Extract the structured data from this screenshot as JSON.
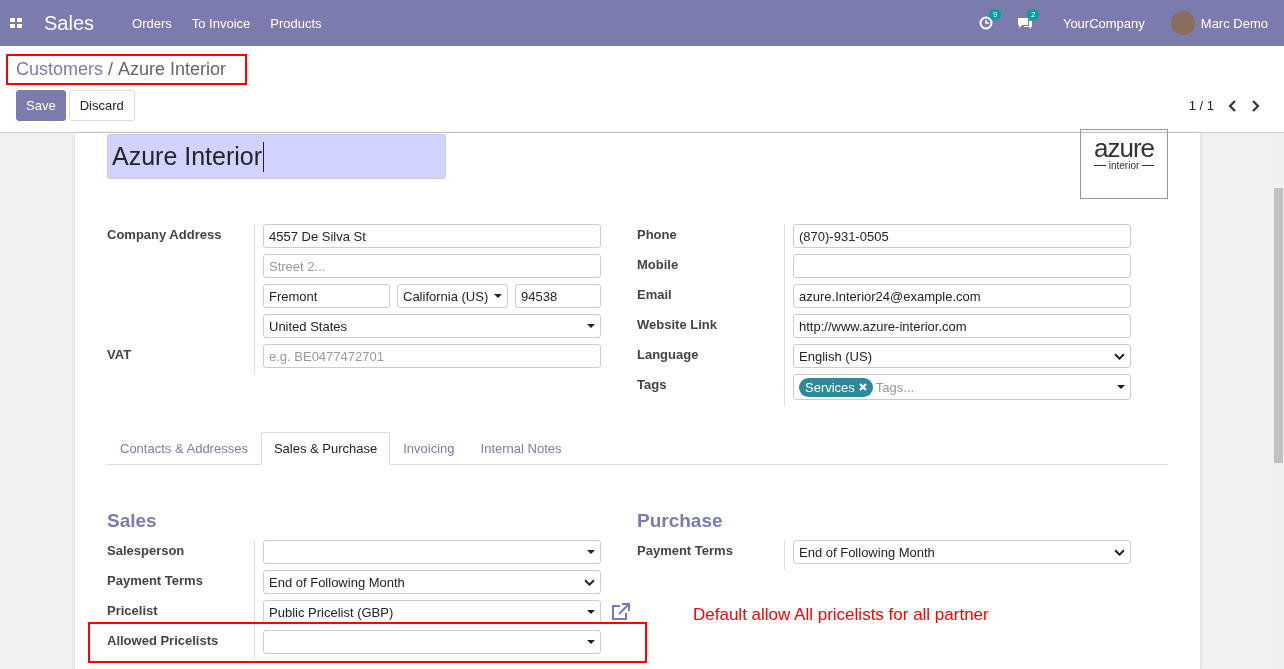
{
  "navbar": {
    "app": "Sales",
    "menu": [
      "Orders",
      "To Invoice",
      "Products"
    ],
    "activity_count": "9",
    "message_count": "2",
    "company": "YourCompany",
    "user": "Marc Demo"
  },
  "breadcrumb": {
    "parent": "Customers",
    "separator": "/",
    "current": "Azure Interior"
  },
  "buttons": {
    "save": "Save",
    "discard": "Discard"
  },
  "pager": "1 / 1",
  "record": {
    "name": "Azure Interior",
    "logo": {
      "word": "azure",
      "sub": "interior"
    }
  },
  "left_fields": [
    {
      "label": "Company Address",
      "rows": [
        [
          {
            "kind": "input",
            "value": "4557 De Silva St"
          }
        ],
        [
          {
            "kind": "input",
            "placeholder": "Street 2..."
          }
        ],
        [
          {
            "kind": "input",
            "value": "Fremont"
          },
          {
            "kind": "dropdown",
            "value": "California (US)"
          },
          {
            "kind": "input",
            "value": "94538"
          }
        ],
        [
          {
            "kind": "dropdown",
            "value": "United States"
          }
        ]
      ]
    },
    {
      "label": "VAT",
      "rows": [
        [
          {
            "kind": "input",
            "placeholder": "e.g. BE0477472701"
          }
        ]
      ]
    }
  ],
  "right_fields": [
    {
      "label": "Phone",
      "rows": [
        [
          {
            "kind": "input",
            "value": "(870)-931-0505"
          }
        ]
      ]
    },
    {
      "label": "Mobile",
      "rows": [
        [
          {
            "kind": "input"
          }
        ]
      ]
    },
    {
      "label": "Email",
      "rows": [
        [
          {
            "kind": "input",
            "value": "azure.Interior24@example.com"
          }
        ]
      ]
    },
    {
      "label": "Website Link",
      "rows": [
        [
          {
            "kind": "input",
            "value": "http://www.azure-interior.com"
          }
        ]
      ]
    },
    {
      "label": "Language",
      "rows": [
        [
          {
            "kind": "select",
            "value": "English (US)"
          }
        ]
      ]
    },
    {
      "label": "Tags",
      "rows": [
        [
          {
            "kind": "tags",
            "tags": [
              "Services"
            ],
            "placeholder": "Tags..."
          }
        ]
      ]
    }
  ],
  "tabs": [
    {
      "label": "Contacts & Addresses",
      "selected": false
    },
    {
      "label": "Sales & Purchase",
      "selected": true
    },
    {
      "label": "Invoicing",
      "selected": false
    },
    {
      "label": "Internal Notes",
      "selected": false
    }
  ],
  "sales": {
    "title": "Sales",
    "fields": [
      {
        "label": "Salesperson",
        "rows": [
          [
            {
              "kind": "dropdown"
            }
          ]
        ]
      },
      {
        "label": "Payment Terms",
        "rows": [
          [
            {
              "kind": "select",
              "value": "End of Following Month"
            }
          ]
        ]
      },
      {
        "label": "Pricelist",
        "rows": [
          [
            {
              "kind": "dropdown",
              "value": "Public Pricelist (GBP)",
              "external_link": true
            }
          ]
        ]
      },
      {
        "label": "Allowed Pricelists",
        "highlighted": true,
        "rows": [
          [
            {
              "kind": "dropdown"
            }
          ]
        ]
      }
    ]
  },
  "purchase": {
    "title": "Purchase",
    "fields": [
      {
        "label": "Payment Terms",
        "rows": [
          [
            {
              "kind": "select",
              "value": "End of Following Month"
            }
          ]
        ]
      }
    ]
  },
  "annotation": "Default allow All pricelists for all partner"
}
